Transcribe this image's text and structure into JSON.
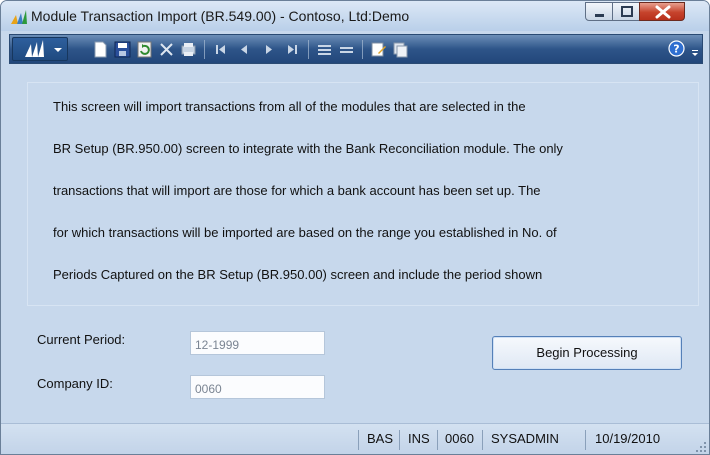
{
  "window": {
    "title": "Module Transaction Import (BR.549.00) - Contoso, Ltd:Demo"
  },
  "toolbar": {
    "icons": [
      "app-menu-icon",
      "new-icon",
      "save-icon",
      "refresh-icon",
      "delete-icon",
      "print-icon",
      "first-icon",
      "prev-icon",
      "next-icon",
      "last-icon",
      "insert-row-icon",
      "delete-row-icon",
      "notes-icon",
      "copy-icon",
      "help-icon"
    ]
  },
  "description": {
    "lines": [
      "This screen will import transactions from all of the modules that are selected in the",
      "BR Setup (BR.950.00) screen to integrate with the Bank Reconciliation module.  The only",
      "transactions that will import are those for which a bank account has been set up.  The",
      "for which transactions will be imported are based on the range you established in No. of",
      "Periods Captured on the BR Setup (BR.950.00) screen and include the period shown"
    ]
  },
  "form": {
    "current_period": {
      "label": "Current Period:",
      "value": "12-1999"
    },
    "company_id": {
      "label": "Company ID:",
      "value": "0060"
    },
    "begin_button": "Begin Processing"
  },
  "status": {
    "module": "BAS",
    "mode": "INS",
    "company": "0060",
    "user": "SYSADMIN",
    "date": "10/19/2010"
  },
  "colors": {
    "window_bg": "#c7d8ec",
    "toolbar_bg": "#2e5589",
    "close_button": "#c6432c"
  }
}
